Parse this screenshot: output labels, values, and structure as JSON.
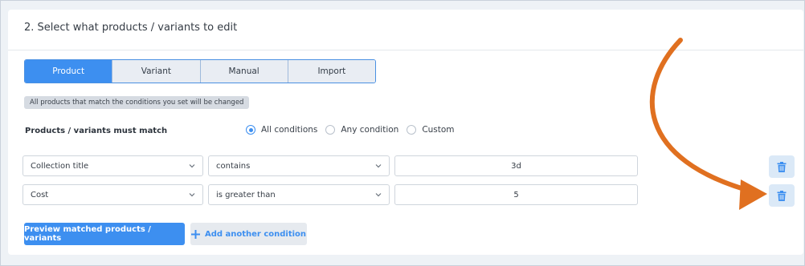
{
  "section": {
    "title": "2. Select what products / variants to edit"
  },
  "tabs": [
    {
      "label": "Product",
      "active": true
    },
    {
      "label": "Variant",
      "active": false
    },
    {
      "label": "Manual",
      "active": false
    },
    {
      "label": "Import",
      "active": false
    }
  ],
  "hint": "All products that match the conditions you set will be changed",
  "match": {
    "label": "Products / variants must match",
    "options": [
      {
        "label": "All conditions",
        "checked": true
      },
      {
        "label": "Any condition",
        "checked": false
      },
      {
        "label": "Custom",
        "checked": false
      }
    ]
  },
  "conditions": [
    {
      "field": "Collection title",
      "operator": "contains",
      "value": "3d"
    },
    {
      "field": "Cost",
      "operator": "is greater than",
      "value": "5"
    }
  ],
  "actions": {
    "preview_label": "Preview matched products / variants",
    "add_label": "Add another condition"
  },
  "colors": {
    "accent": "#3d8ff0",
    "annotation_arrow": "#e07020"
  },
  "icons": {
    "dropdown": "chevron-down-icon",
    "delete": "trash-icon",
    "add": "plus-icon",
    "annotation": "curved-arrow-icon"
  }
}
